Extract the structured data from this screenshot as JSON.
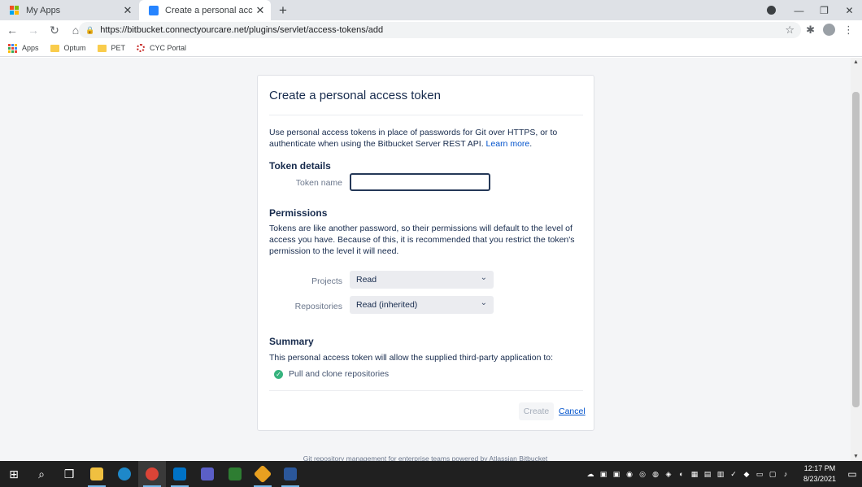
{
  "browser": {
    "tabs": [
      {
        "title": "My Apps",
        "active": false
      },
      {
        "title": "Create a personal access token -",
        "active": true
      }
    ],
    "url": "https://bitbucket.connectyourcare.net/plugins/servlet/access-tokens/add",
    "bookmarks": [
      {
        "label": "Apps"
      },
      {
        "label": "Optum"
      },
      {
        "label": "PET"
      },
      {
        "label": "CYC Portal"
      }
    ]
  },
  "form": {
    "title": "Create a personal access token",
    "intro": "Use personal access tokens in place of passwords for Git over HTTPS, or to authenticate when using the Bitbucket Server REST API.",
    "learn_more": "Learn more",
    "intro_end": ".",
    "token_details_heading": "Token details",
    "token_name_label": "Token name",
    "token_name_value": "",
    "permissions_heading": "Permissions",
    "permissions_text": "Tokens are like another password, so their permissions will default to the level of access you have. Because of this, it is recommended that you restrict the token's permission to the level it will need.",
    "projects_label": "Projects",
    "projects_value": "Read",
    "repositories_label": "Repositories",
    "repositories_value": "Read (inherited)",
    "summary_heading": "Summary",
    "summary_text": "This personal access token will allow the supplied third-party application to:",
    "summary_items": [
      "Pull and clone repositories"
    ],
    "create_label": "Create",
    "cancel_label": "Cancel"
  },
  "footer": "Git repository management for enterprise teams powered by Atlassian Bitbucket",
  "taskbar": {
    "time": "12:17 PM",
    "date": "8/23/2021"
  },
  "colors": {
    "link": "#0052cc",
    "heading": "#172b4d",
    "success": "#36b37e"
  }
}
